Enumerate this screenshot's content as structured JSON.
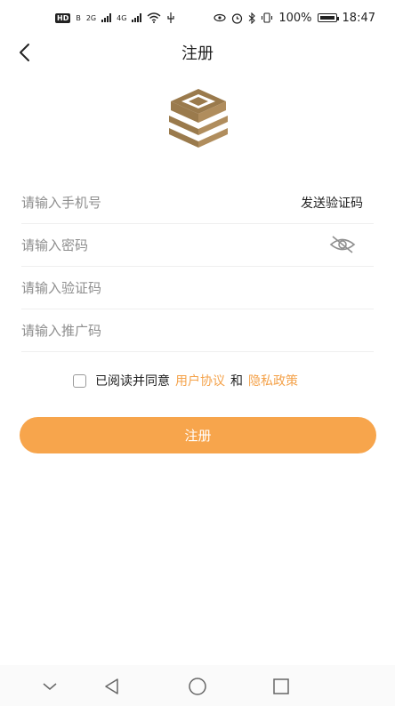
{
  "statusbar": {
    "hd": "HD",
    "b": "B",
    "net1": "2G",
    "net2": "4G",
    "battery": "100%",
    "time": "18:47"
  },
  "header": {
    "title": "注册",
    "back_icon": "chevron-left-icon"
  },
  "logo": {
    "icon": "brand-logo",
    "color": "#9a7a4c"
  },
  "form": {
    "phone_placeholder": "请输入手机号",
    "send_code_label": "发送验证码",
    "password_placeholder": "请输入密码",
    "password_toggle_icon": "eye-off-icon",
    "code_placeholder": "请输入验证码",
    "promo_placeholder": "请输入推广码"
  },
  "agreement": {
    "prefix": "已阅读并同意",
    "user_agreement": "用户协议",
    "and": "和",
    "privacy_policy": "隐私政策",
    "checked": false
  },
  "register_button": {
    "label": "注册",
    "color": "#f7a54c"
  },
  "navbar": {
    "icons": [
      "chevron-down-icon",
      "back-triangle-icon",
      "home-circle-icon",
      "recent-square-icon"
    ]
  },
  "colors": {
    "accent": "#f4a24a",
    "text": "#222222",
    "placeholder": "#8e8e8e"
  }
}
